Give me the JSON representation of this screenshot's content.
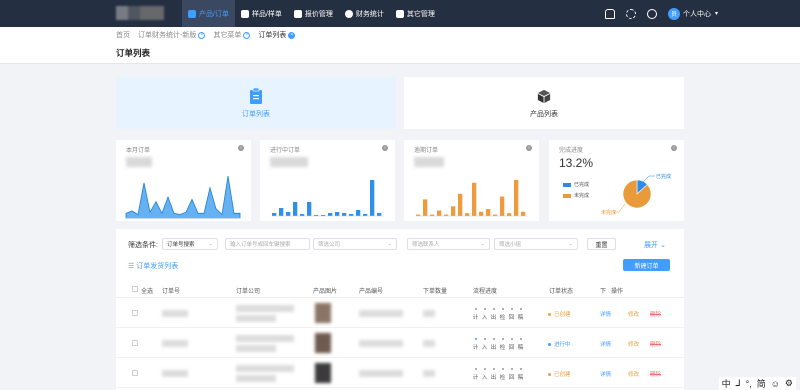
{
  "nav": {
    "items": [
      {
        "label": "产品/订单",
        "icon": "product-icon",
        "active": true
      },
      {
        "label": "样品/样单",
        "icon": "sample-icon"
      },
      {
        "label": "报价管理",
        "icon": "quote-icon"
      },
      {
        "label": "财务统计",
        "icon": "finance-icon"
      },
      {
        "label": "其它管理",
        "icon": "grid-icon"
      }
    ],
    "user_initial": "员",
    "user_label": "个人中心",
    "caret": "▾"
  },
  "breadcrumb": {
    "items": [
      {
        "label": "首页",
        "closable": false
      },
      {
        "label": "订单财务统计-新版",
        "closable": true
      },
      {
        "label": "其它菜单",
        "closable": true
      },
      {
        "label": "订单列表",
        "closable": true,
        "current": true
      }
    ]
  },
  "page_title": "订单列表",
  "tiles": [
    {
      "label": "订单列表",
      "icon": "clipboard-icon",
      "active": true
    },
    {
      "label": "产品列表",
      "icon": "box-icon"
    }
  ],
  "stats": {
    "monthly": {
      "label": "本月订单"
    },
    "in_progress": {
      "label": "进行中订单"
    },
    "overdue": {
      "label": "逾期订单"
    },
    "completion": {
      "label": "完成进度",
      "percent": "13.2%",
      "fraction": 0.132,
      "legend_done": "已完成",
      "legend_undone": "未完成",
      "colors": {
        "done": "#2d8ce8",
        "undone": "#e99a3a"
      }
    }
  },
  "chart_data": [
    {
      "type": "area",
      "series": [
        {
          "values": [
            4,
            6,
            3,
            30,
            5,
            14,
            4,
            18,
            4,
            3,
            5,
            16,
            4,
            4,
            26,
            8,
            3,
            36,
            4,
            4
          ]
        }
      ]
    },
    {
      "type": "bar",
      "series": [
        {
          "values": [
            3,
            8,
            4,
            14,
            2,
            14,
            1,
            1,
            3,
            4,
            3,
            2,
            6,
            2,
            36,
            3
          ]
        }
      ]
    },
    {
      "type": "bar",
      "series": [
        {
          "values": [
            1,
            12,
            1,
            4,
            1,
            7,
            16,
            2,
            24,
            3,
            5,
            1,
            14,
            2,
            26,
            3
          ]
        }
      ]
    },
    {
      "type": "pie",
      "categories": [
        "已完成",
        "未完成"
      ],
      "values": [
        13.2,
        86.8
      ]
    }
  ],
  "filter": {
    "label": "筛选条件:",
    "type_value": "订单号搜索",
    "keyword_placeholder": "输入订单号或回车键搜索",
    "company_placeholder": "筛选公司",
    "contact_placeholder": "筛选联系人",
    "group_placeholder": "筛选小组",
    "reset": "重置",
    "expand": "展开"
  },
  "toolbar": {
    "ship_list": "订单发货列表",
    "new_order": "新建订单"
  },
  "table": {
    "columns": [
      "全选",
      "订单号",
      "订单公司",
      "产品图片",
      "产品编号",
      "下单数量",
      "流程进度",
      "订单状态",
      "下",
      "操作"
    ],
    "step_labels": [
      "计",
      "入",
      "出",
      "检",
      "回",
      "稿"
    ],
    "rows": [
      {
        "status": "已创建",
        "status_color": "#e6a23c",
        "steps_on": 0,
        "actions": [
          "详情",
          "修改",
          "删除"
        ]
      },
      {
        "status": "进行中",
        "status_color": "#409eff",
        "steps_on": 1,
        "actions": [
          "详情",
          "修改",
          "删除"
        ]
      },
      {
        "status": "已创建",
        "status_color": "#e6a23c",
        "steps_on": 0,
        "actions": [
          "详情",
          "修改",
          "删除"
        ]
      }
    ]
  },
  "ime": {
    "items": [
      "中",
      "⅃",
      "°,",
      "简",
      "☺",
      "⚙"
    ]
  }
}
